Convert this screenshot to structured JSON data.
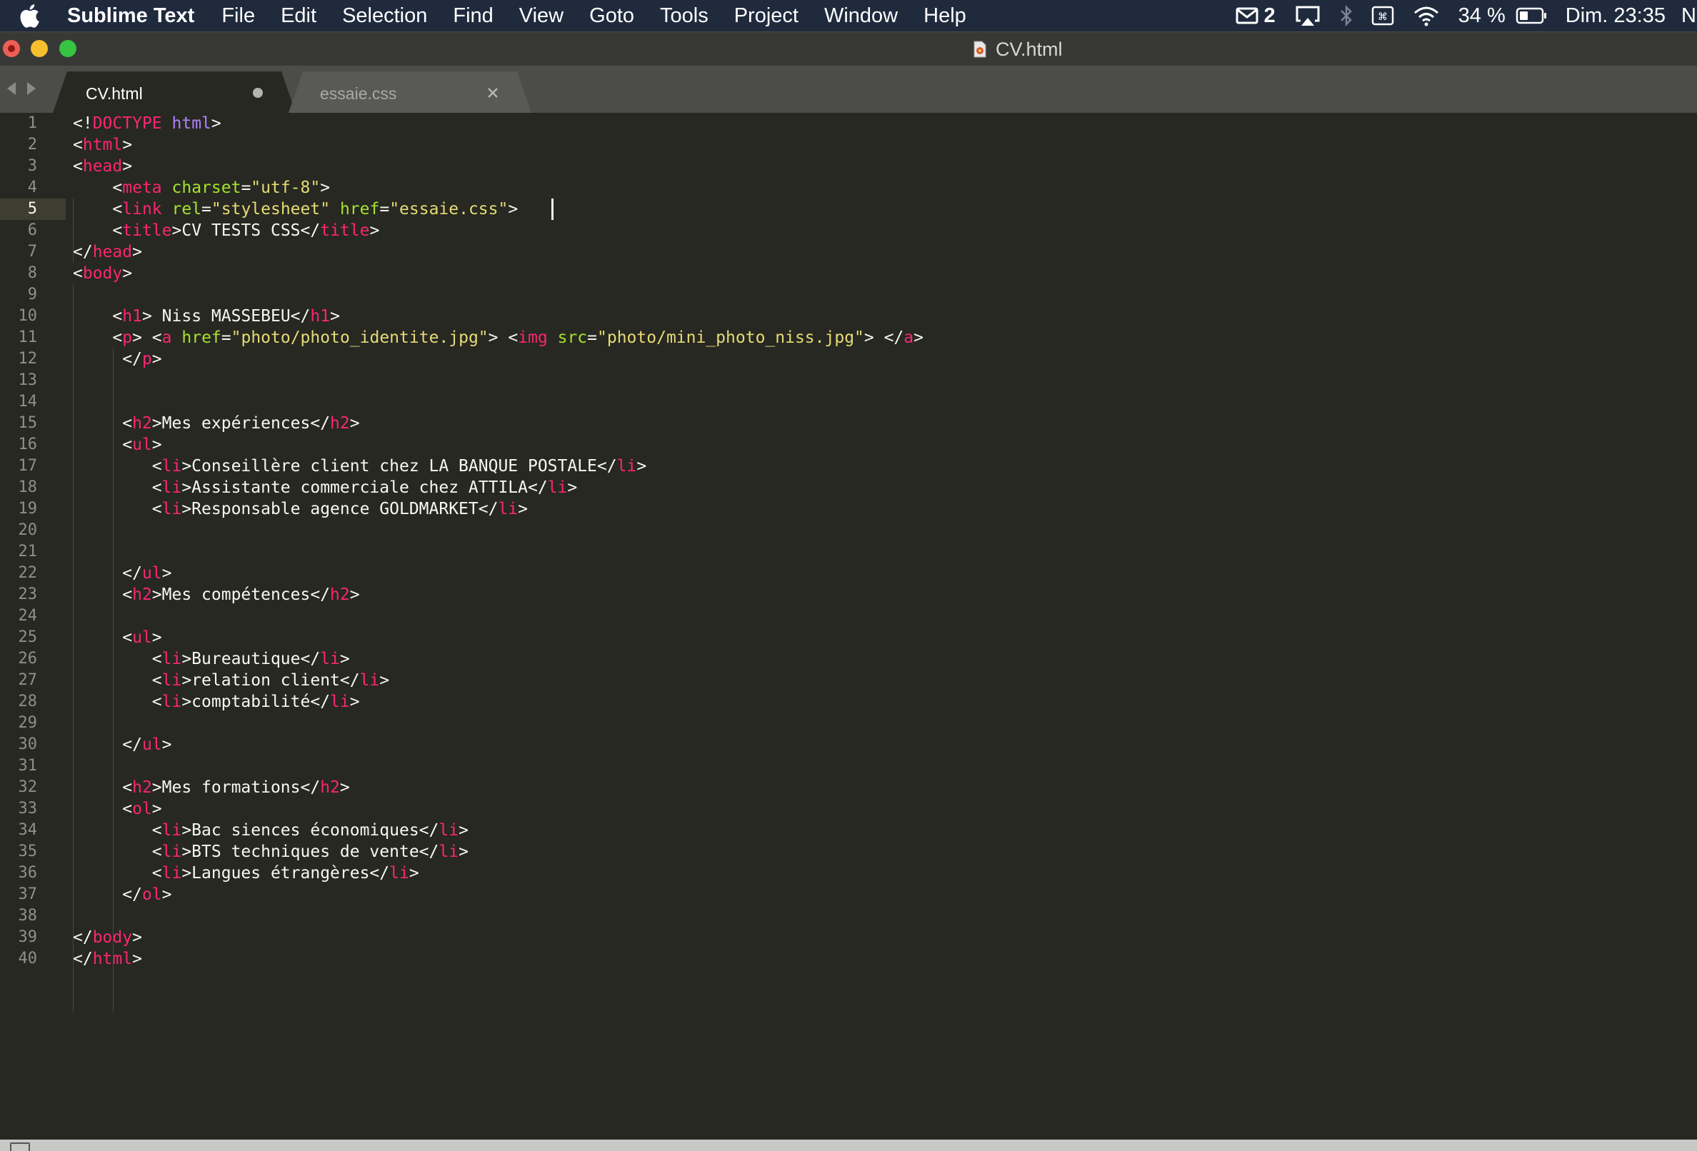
{
  "menubar": {
    "app_name": "Sublime Text",
    "menus": [
      "File",
      "Edit",
      "Selection",
      "Find",
      "View",
      "Goto",
      "Tools",
      "Project",
      "Window",
      "Help"
    ],
    "mail_count": "2",
    "battery": "34 %",
    "clock": "Dim. 23:35",
    "user": "Ni",
    "icons": [
      "apple-icon",
      "mail-icon",
      "airplay-icon",
      "bluetooth-icon",
      "keyboard-icon",
      "wifi-icon",
      "battery-icon"
    ]
  },
  "window": {
    "title": "CV.html",
    "colors": {
      "close": "#ee5e56",
      "minimize": "#f7be2e",
      "zoom": "#37c441"
    }
  },
  "tabs": [
    {
      "label": "CV.html",
      "active": true,
      "modified": true
    },
    {
      "label": "essaie.css",
      "active": false,
      "modified": false
    }
  ],
  "editor": {
    "current_line": 5,
    "lines": [
      [
        [
          "p",
          "<!"
        ],
        [
          "tag",
          "DOCTYPE"
        ],
        [
          "p",
          " "
        ],
        [
          "kw",
          "html"
        ],
        [
          "p",
          ">"
        ]
      ],
      [
        [
          "p",
          "<"
        ],
        [
          "tag",
          "html"
        ],
        [
          "p",
          ">"
        ]
      ],
      [
        [
          "p",
          "<"
        ],
        [
          "tag",
          "head"
        ],
        [
          "p",
          ">"
        ]
      ],
      [
        [
          "p",
          "    <"
        ],
        [
          "tag",
          "meta"
        ],
        [
          "p",
          " "
        ],
        [
          "attr",
          "charset"
        ],
        [
          "p",
          "="
        ],
        [
          "str",
          "\"utf-8\""
        ],
        [
          "p",
          ">"
        ]
      ],
      [
        [
          "p",
          "    <"
        ],
        [
          "tag",
          "link"
        ],
        [
          "p",
          " "
        ],
        [
          "attr",
          "rel"
        ],
        [
          "p",
          "="
        ],
        [
          "str",
          "\"stylesheet\""
        ],
        [
          "p",
          " "
        ],
        [
          "attr",
          "href"
        ],
        [
          "p",
          "="
        ],
        [
          "str",
          "\"essaie.css\""
        ],
        [
          "p",
          ">"
        ]
      ],
      [
        [
          "p",
          "    <"
        ],
        [
          "tag",
          "title"
        ],
        [
          "p",
          ">CV TESTS CSS</"
        ],
        [
          "tag",
          "title"
        ],
        [
          "p",
          ">"
        ]
      ],
      [
        [
          "p",
          "</"
        ],
        [
          "tag",
          "head"
        ],
        [
          "p",
          ">"
        ]
      ],
      [
        [
          "p",
          "<"
        ],
        [
          "tag",
          "body"
        ],
        [
          "p",
          ">"
        ]
      ],
      [],
      [
        [
          "p",
          "    <"
        ],
        [
          "tag",
          "h1"
        ],
        [
          "p",
          "> Niss MASSEBEU</"
        ],
        [
          "tag",
          "h1"
        ],
        [
          "p",
          ">"
        ]
      ],
      [
        [
          "p",
          "    <"
        ],
        [
          "tag",
          "p"
        ],
        [
          "p",
          "> <"
        ],
        [
          "tag",
          "a"
        ],
        [
          "p",
          " "
        ],
        [
          "attr",
          "href"
        ],
        [
          "p",
          "="
        ],
        [
          "str",
          "\"photo/photo_identite.jpg\""
        ],
        [
          "p",
          "> <"
        ],
        [
          "tag",
          "img"
        ],
        [
          "p",
          " "
        ],
        [
          "attr",
          "src"
        ],
        [
          "p",
          "="
        ],
        [
          "str",
          "\"photo/mini_photo_niss.jpg\""
        ],
        [
          "p",
          "> </"
        ],
        [
          "tag",
          "a"
        ],
        [
          "p",
          ">"
        ]
      ],
      [
        [
          "p",
          "     </"
        ],
        [
          "tag",
          "p"
        ],
        [
          "p",
          ">"
        ]
      ],
      [],
      [],
      [
        [
          "p",
          "     <"
        ],
        [
          "tag",
          "h2"
        ],
        [
          "p",
          ">Mes expériences</"
        ],
        [
          "tag",
          "h2"
        ],
        [
          "p",
          ">"
        ]
      ],
      [
        [
          "p",
          "     <"
        ],
        [
          "tag",
          "ul"
        ],
        [
          "p",
          ">"
        ]
      ],
      [
        [
          "p",
          "        <"
        ],
        [
          "tag",
          "li"
        ],
        [
          "p",
          ">Conseillère client chez LA BANQUE POSTALE</"
        ],
        [
          "tag",
          "li"
        ],
        [
          "p",
          ">"
        ]
      ],
      [
        [
          "p",
          "        <"
        ],
        [
          "tag",
          "li"
        ],
        [
          "p",
          ">Assistante commerciale chez ATTILA</"
        ],
        [
          "tag",
          "li"
        ],
        [
          "p",
          ">"
        ]
      ],
      [
        [
          "p",
          "        <"
        ],
        [
          "tag",
          "li"
        ],
        [
          "p",
          ">Responsable agence GOLDMARKET</"
        ],
        [
          "tag",
          "li"
        ],
        [
          "p",
          ">"
        ]
      ],
      [],
      [],
      [
        [
          "p",
          "     </"
        ],
        [
          "tag",
          "ul"
        ],
        [
          "p",
          ">"
        ]
      ],
      [
        [
          "p",
          "     <"
        ],
        [
          "tag",
          "h2"
        ],
        [
          "p",
          ">Mes compétences</"
        ],
        [
          "tag",
          "h2"
        ],
        [
          "p",
          ">"
        ]
      ],
      [],
      [
        [
          "p",
          "     <"
        ],
        [
          "tag",
          "ul"
        ],
        [
          "p",
          ">"
        ]
      ],
      [
        [
          "p",
          "        <"
        ],
        [
          "tag",
          "li"
        ],
        [
          "p",
          ">Bureautique</"
        ],
        [
          "tag",
          "li"
        ],
        [
          "p",
          ">"
        ]
      ],
      [
        [
          "p",
          "        <"
        ],
        [
          "tag",
          "li"
        ],
        [
          "p",
          ">relation client</"
        ],
        [
          "tag",
          "li"
        ],
        [
          "p",
          ">"
        ]
      ],
      [
        [
          "p",
          "        <"
        ],
        [
          "tag",
          "li"
        ],
        [
          "p",
          ">comptabilité</"
        ],
        [
          "tag",
          "li"
        ],
        [
          "p",
          ">"
        ]
      ],
      [],
      [
        [
          "p",
          "     </"
        ],
        [
          "tag",
          "ul"
        ],
        [
          "p",
          ">"
        ]
      ],
      [],
      [
        [
          "p",
          "     <"
        ],
        [
          "tag",
          "h2"
        ],
        [
          "p",
          ">Mes formations</"
        ],
        [
          "tag",
          "h2"
        ],
        [
          "p",
          ">"
        ]
      ],
      [
        [
          "p",
          "     <"
        ],
        [
          "tag",
          "ol"
        ],
        [
          "p",
          ">"
        ]
      ],
      [
        [
          "p",
          "        <"
        ],
        [
          "tag",
          "li"
        ],
        [
          "p",
          ">Bac siences économiques</"
        ],
        [
          "tag",
          "li"
        ],
        [
          "p",
          ">"
        ]
      ],
      [
        [
          "p",
          "        <"
        ],
        [
          "tag",
          "li"
        ],
        [
          "p",
          ">BTS techniques de vente</"
        ],
        [
          "tag",
          "li"
        ],
        [
          "p",
          ">"
        ]
      ],
      [
        [
          "p",
          "        <"
        ],
        [
          "tag",
          "li"
        ],
        [
          "p",
          ">Langues étrangères</"
        ],
        [
          "tag",
          "li"
        ],
        [
          "p",
          ">"
        ]
      ],
      [
        [
          "p",
          "     </"
        ],
        [
          "tag",
          "ol"
        ],
        [
          "p",
          ">"
        ]
      ],
      [],
      [
        [
          "p",
          "</"
        ],
        [
          "tag",
          "body"
        ],
        [
          "p",
          ">"
        ]
      ],
      [
        [
          "p",
          "</"
        ],
        [
          "tag",
          "html"
        ],
        [
          "p",
          ">"
        ]
      ]
    ],
    "colors": {
      "background": "#272822",
      "tag": "#f92672",
      "attribute": "#a6e22e",
      "string": "#e6db74",
      "keyword": "#ae81ff",
      "text": "#f8f8f2",
      "line_number": "#90908a"
    }
  }
}
